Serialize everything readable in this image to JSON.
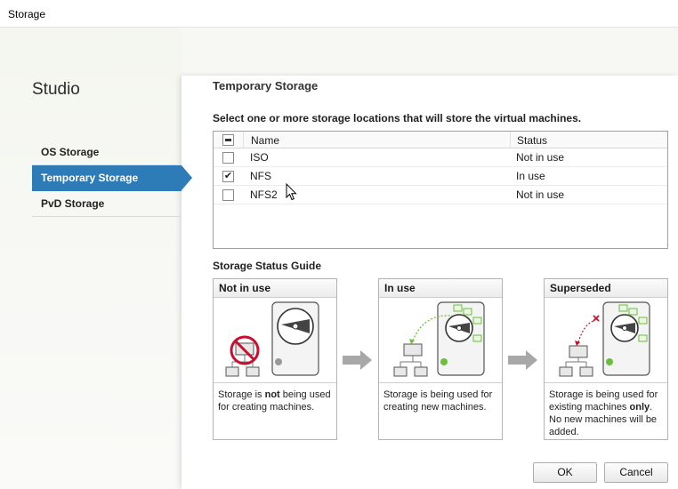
{
  "window": {
    "title": "Storage"
  },
  "sidebar": {
    "brand": "Studio",
    "items": [
      {
        "label": "OS Storage",
        "active": false
      },
      {
        "label": "Temporary Storage",
        "active": true
      },
      {
        "label": "PvD Storage",
        "active": false
      }
    ]
  },
  "main": {
    "heading": "Temporary Storage",
    "instruction": "Select one or more storage locations that will store the virtual machines.",
    "table": {
      "columns": {
        "name": "Name",
        "status": "Status"
      },
      "rows": [
        {
          "name": "ISO",
          "status": "Not in use",
          "checked": false
        },
        {
          "name": "NFS",
          "status": "In use",
          "checked": true
        },
        {
          "name": "NFS2",
          "status": "Not in use",
          "checked": false
        }
      ]
    },
    "guide": {
      "title": "Storage Status Guide",
      "cards": [
        {
          "title": "Not in use",
          "parts": [
            "Storage is ",
            "not",
            " being used for creating machines."
          ]
        },
        {
          "title": "In use",
          "parts": [
            "Storage is being used for creating new machines.",
            "",
            ""
          ]
        },
        {
          "title": "Superseded",
          "parts": [
            "Storage is being used for existing machines ",
            "only",
            ". No new machines will be added."
          ]
        }
      ]
    }
  },
  "footer": {
    "ok_label": "OK",
    "cancel_label": "Cancel"
  },
  "colors": {
    "accent": "#2e7cb7",
    "in_use_dot": "#6abf3f",
    "prohibited": "#c8102e"
  }
}
